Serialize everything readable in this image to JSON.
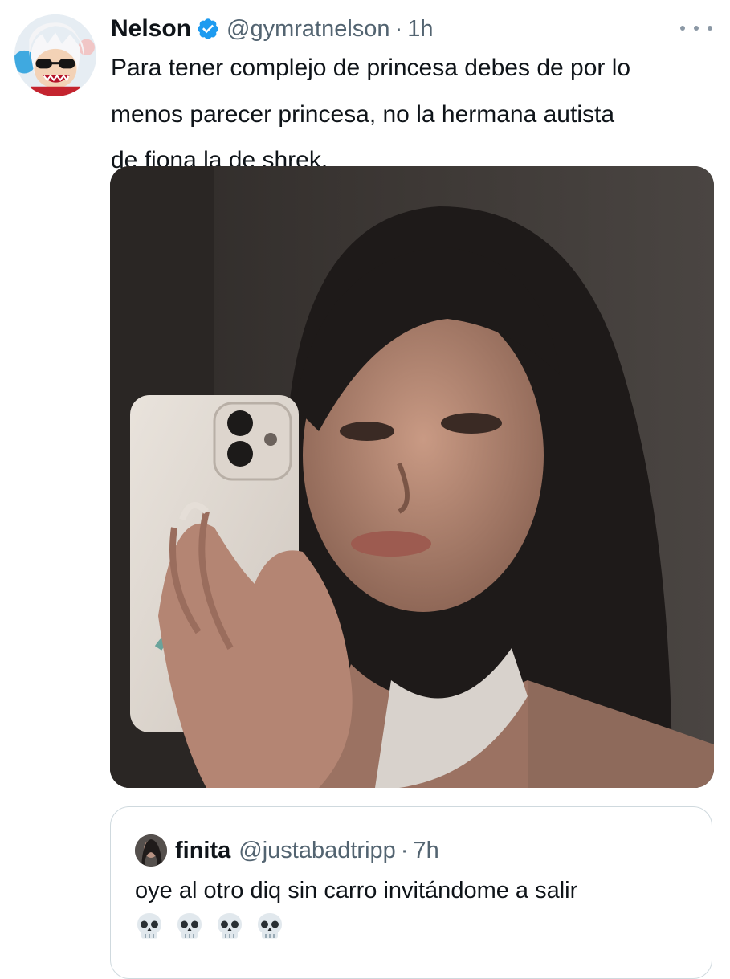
{
  "tweet": {
    "display_name": "Nelson",
    "verified_icon": "verified-badge-icon",
    "handle": "@gymratnelson",
    "separator": "·",
    "time": "1h",
    "more_icon": "more-horizontal-icon",
    "text": "Para tener complejo de princesa debes de por lo\nmenos parecer princesa, no la hermana autista\nde fiona la de shrek.",
    "media": {
      "type": "photo",
      "icon": "photo-mirror-selfie"
    }
  },
  "quote": {
    "display_name": "finita",
    "handle": "@justabadtripp",
    "separator": "·",
    "time": "7h",
    "text": "oye al otro diq sin carro invitándome a salir",
    "emojis": [
      "skull-icon",
      "skull-icon",
      "skull-icon",
      "skull-icon"
    ]
  },
  "colors": {
    "text_primary": "#0f1419",
    "text_secondary": "#536471",
    "verified_blue": "#1d9bf0",
    "border": "#cfd9de"
  }
}
